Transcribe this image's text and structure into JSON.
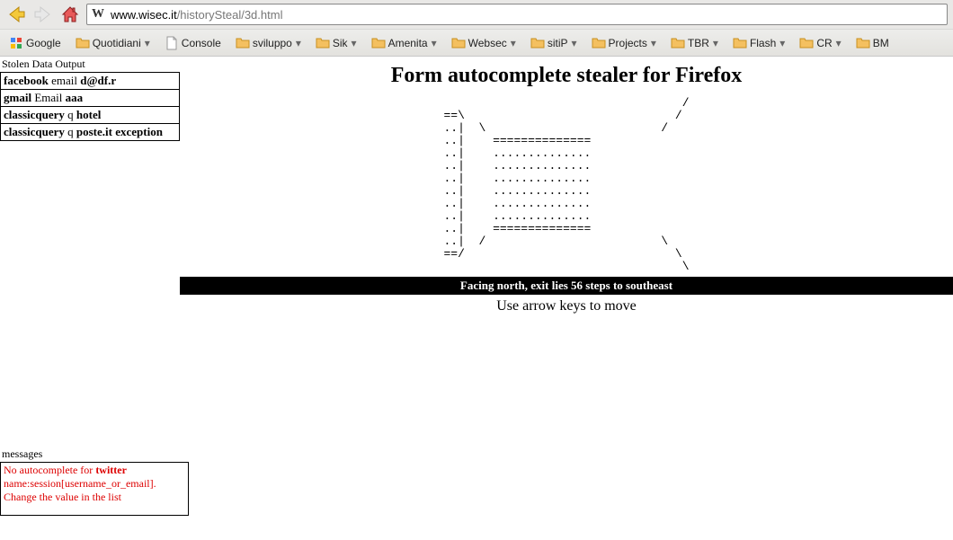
{
  "url": {
    "host": "www.wisec.it",
    "path": "/historySteal/3d.html"
  },
  "bookmarks": [
    {
      "label": "Google",
      "icon": "google",
      "dropdown": false
    },
    {
      "label": "Quotidiani",
      "icon": "folder",
      "dropdown": true
    },
    {
      "label": "Console",
      "icon": "page",
      "dropdown": false
    },
    {
      "label": "sviluppo",
      "icon": "folder",
      "dropdown": true
    },
    {
      "label": "Sik",
      "icon": "folder",
      "dropdown": true
    },
    {
      "label": "Amenita",
      "icon": "folder",
      "dropdown": true
    },
    {
      "label": "Websec",
      "icon": "folder",
      "dropdown": true
    },
    {
      "label": "sitiP",
      "icon": "folder",
      "dropdown": true
    },
    {
      "label": "Projects",
      "icon": "folder",
      "dropdown": true
    },
    {
      "label": "TBR",
      "icon": "folder",
      "dropdown": true
    },
    {
      "label": "Flash",
      "icon": "folder",
      "dropdown": true
    },
    {
      "label": "CR",
      "icon": "folder",
      "dropdown": true
    },
    {
      "label": "BM",
      "icon": "folder",
      "dropdown": false
    }
  ],
  "stolen": {
    "label": "Stolen Data Output",
    "rows": [
      {
        "site": "facebook",
        "field": "email",
        "value": "d@df.r"
      },
      {
        "site": "gmail",
        "field": "Email",
        "value": "aaa"
      },
      {
        "site": "classicquery",
        "field": "q",
        "value": "hotel"
      },
      {
        "site": "classicquery",
        "field": "q",
        "value": "poste.it exception"
      }
    ]
  },
  "messages": {
    "label": "messages",
    "line1_pre": "No autocomplete for ",
    "line1_bold": "twitter",
    "line2": "name:session[username_or_email].",
    "line3": "Change the value in the list"
  },
  "main": {
    "title": "Form autocomplete stealer for Firefox",
    "ascii": "                                  /\n==\\                              /\n..|  \\                         /\n..|    ==============\n..|    ..............\n..|    ..............\n..|    ..............\n..|    ..............\n..|    ..............\n..|    ..............\n..|    ==============\n..|  /                         \\\n==/                              \\\n                                  \\",
    "status": "Facing north, exit lies 56 steps to southeast",
    "instruct": "Use arrow keys to move"
  }
}
